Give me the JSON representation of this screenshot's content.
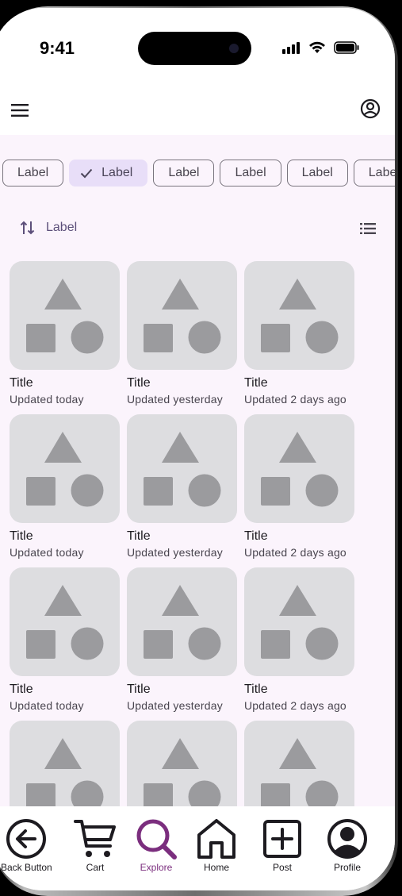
{
  "status_bar": {
    "time": "9:41"
  },
  "chips": [
    {
      "label": "Label",
      "selected": false
    },
    {
      "label": "Label",
      "selected": true
    },
    {
      "label": "Label",
      "selected": false
    },
    {
      "label": "Label",
      "selected": false
    },
    {
      "label": "Label",
      "selected": false
    },
    {
      "label": "Label",
      "selected": false
    }
  ],
  "sort": {
    "label": "Label"
  },
  "cards": [
    {
      "title": "Title",
      "subtitle": "Updated today"
    },
    {
      "title": "Title",
      "subtitle": "Updated yesterday"
    },
    {
      "title": "Title",
      "subtitle": "Updated 2 days ago"
    },
    {
      "title": "Title",
      "subtitle": "Updated today"
    },
    {
      "title": "Title",
      "subtitle": "Updated yesterday"
    },
    {
      "title": "Title",
      "subtitle": "Updated 2 days ago"
    },
    {
      "title": "Title",
      "subtitle": "Updated today"
    },
    {
      "title": "Title",
      "subtitle": "Updated yesterday"
    },
    {
      "title": "Title",
      "subtitle": "Updated 2 days ago"
    },
    {
      "title": "",
      "subtitle": ""
    },
    {
      "title": "",
      "subtitle": ""
    },
    {
      "title": "",
      "subtitle": ""
    }
  ],
  "nav": [
    {
      "label": "Back Button",
      "icon": "back-arrow-icon"
    },
    {
      "label": "Cart",
      "icon": "cart-icon"
    },
    {
      "label": "Explore",
      "icon": "search-icon",
      "active": true
    },
    {
      "label": "Home",
      "icon": "home-icon"
    },
    {
      "label": "Post",
      "icon": "add-box-icon"
    },
    {
      "label": "Profile",
      "icon": "profile-icon"
    }
  ],
  "colors": {
    "accent": "#7b2e7e",
    "selected_chip": "#e8def8",
    "surface": "#fbf4fc",
    "thumb": "#dddde0"
  }
}
